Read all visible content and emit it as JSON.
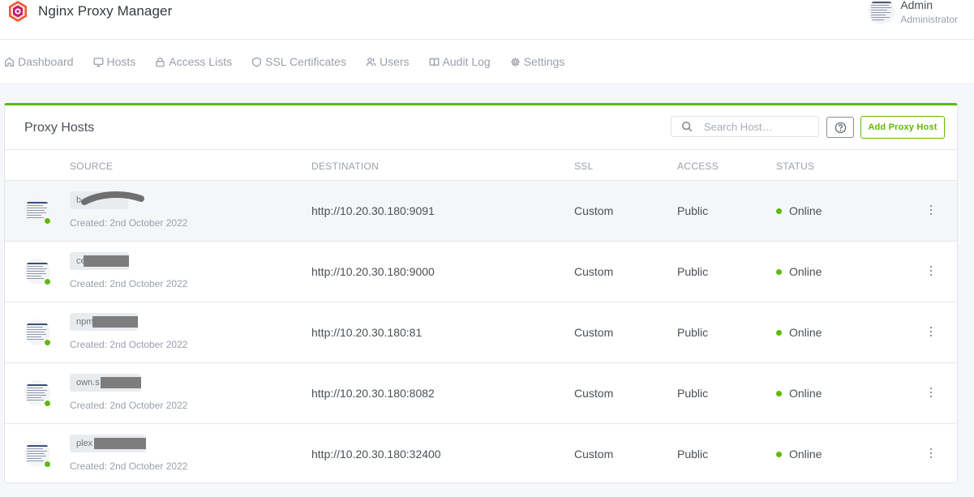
{
  "app": {
    "title": "Nginx Proxy Manager",
    "user_name": "Admin",
    "user_role": "Administrator"
  },
  "nav": [
    {
      "label": "Dashboard",
      "icon": "home-icon"
    },
    {
      "label": "Hosts",
      "icon": "monitor-icon"
    },
    {
      "label": "Access Lists",
      "icon": "lock-icon"
    },
    {
      "label": "SSL Certificates",
      "icon": "shield-icon"
    },
    {
      "label": "Users",
      "icon": "users-icon"
    },
    {
      "label": "Audit Log",
      "icon": "book-icon"
    },
    {
      "label": "Settings",
      "icon": "gear-icon"
    }
  ],
  "card": {
    "title": "Proxy Hosts",
    "search_placeholder": "Search Host…",
    "add_label": "Add Proxy Host"
  },
  "columns": [
    "SOURCE",
    "DESTINATION",
    "SSL",
    "ACCESS",
    "STATUS"
  ],
  "rows": [
    {
      "domain": "b",
      "created": "Created: 2nd October 2022",
      "destination": "http://10.20.30.180:9091",
      "ssl": "Custom",
      "access": "Public",
      "status": "Online"
    },
    {
      "domain": "ce",
      "created": "Created: 2nd October 2022",
      "destination": "http://10.20.30.180:9000",
      "ssl": "Custom",
      "access": "Public",
      "status": "Online"
    },
    {
      "domain": "npm",
      "created": "Created: 2nd October 2022",
      "destination": "http://10.20.30.180:81",
      "ssl": "Custom",
      "access": "Public",
      "status": "Online"
    },
    {
      "domain": "own.s",
      "created": "Created: 2nd October 2022",
      "destination": "http://10.20.30.180:8082",
      "ssl": "Custom",
      "access": "Public",
      "status": "Online"
    },
    {
      "domain": "plex",
      "created": "Created: 2nd October 2022",
      "destination": "http://10.20.30.180:32400",
      "ssl": "Custom",
      "access": "Public",
      "status": "Online"
    }
  ],
  "colors": {
    "accent": "#5eba00",
    "text": "#495057",
    "muted": "#9aa0ac"
  }
}
